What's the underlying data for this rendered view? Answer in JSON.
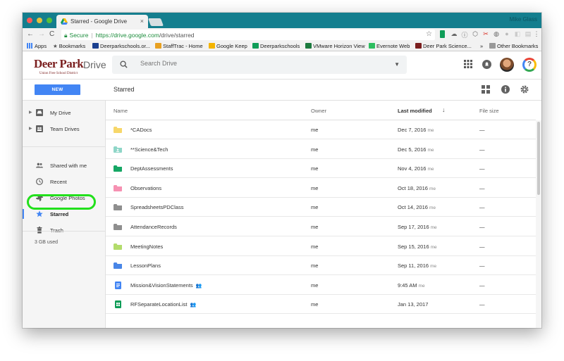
{
  "browser": {
    "tab_title": "Starred - Google Drive",
    "tab_close": "×",
    "profile_name": "Mike Glass",
    "secure_label": "Secure",
    "url_host": "https://drive.google.com",
    "url_path": "/drive/starred",
    "nav_back": "←",
    "nav_forward": "→",
    "nav_reload": "C",
    "bookmark_star": "☆"
  },
  "bookmarks": [
    {
      "label": "Apps",
      "color": "#4285f4"
    },
    {
      "label": "Bookmarks",
      "color": "#555555"
    },
    {
      "label": "Deerparkschools.or...",
      "color": "#1a3f8f"
    },
    {
      "label": "StaffTrac - Home",
      "color": "#e8a020"
    },
    {
      "label": "Google Keep",
      "color": "#f4b400"
    },
    {
      "label": "Deerparkschools",
      "color": "#0f9d58"
    },
    {
      "label": "VMware Horizon View",
      "color": "#1c7a3e"
    },
    {
      "label": "Evernote Web",
      "color": "#2dbe60"
    },
    {
      "label": "Deer Park Science...",
      "color": "#7a1e1e"
    },
    {
      "label": "»",
      "color": "#f2f2f2"
    },
    {
      "label": "Other Bookmarks",
      "color": "#999999"
    }
  ],
  "header": {
    "logo_title": "Deer Park",
    "logo_subtitle": "Union Free School District",
    "app_name": "Drive",
    "search_placeholder": "Search Drive",
    "help_glyph": "?"
  },
  "toolbar": {
    "new_label": "NEW",
    "page_title": "Starred"
  },
  "sidebar": {
    "items": [
      {
        "label": "My Drive",
        "icon": "my-drive-icon"
      },
      {
        "label": "Team Drives",
        "icon": "team-drives-icon"
      },
      {
        "label": "Shared with me",
        "icon": "shared-icon"
      },
      {
        "label": "Recent",
        "icon": "clock-icon"
      },
      {
        "label": "Google Photos",
        "icon": "photos-icon"
      },
      {
        "label": "Starred",
        "icon": "star-icon"
      },
      {
        "label": "Trash",
        "icon": "trash-icon"
      }
    ],
    "storage": "3 GB used"
  },
  "list": {
    "columns": {
      "name": "Name",
      "owner": "Owner",
      "modified": "Last modified",
      "size": "File size"
    },
    "rows": [
      {
        "name": "*CADocs",
        "owner": "me",
        "modified": "Dec 7, 2016",
        "by": "me",
        "size": "—",
        "type": "folder",
        "color": "#f7d76a",
        "shared": ""
      },
      {
        "name": "**Science&Tech",
        "owner": "me",
        "modified": "Dec 5, 2016",
        "by": "me",
        "size": "—",
        "type": "shared-folder",
        "color": "#8fd6c8",
        "shared": ""
      },
      {
        "name": "DeptAssessments",
        "owner": "me",
        "modified": "Nov 4, 2016",
        "by": "me",
        "size": "—",
        "type": "folder",
        "color": "#16a765",
        "shared": ""
      },
      {
        "name": "Observations",
        "owner": "me",
        "modified": "Oct 18, 2016",
        "by": "me",
        "size": "—",
        "type": "folder",
        "color": "#f691b2",
        "shared": ""
      },
      {
        "name": "SpreadsheetsPDClass",
        "owner": "me",
        "modified": "Oct 14, 2016",
        "by": "me",
        "size": "—",
        "type": "folder",
        "color": "#8f8f8f",
        "shared": ""
      },
      {
        "name": "AttendanceRecords",
        "owner": "me",
        "modified": "Sep 17, 2016",
        "by": "me",
        "size": "—",
        "type": "folder",
        "color": "#8f8f8f",
        "shared": ""
      },
      {
        "name": "MeetingNotes",
        "owner": "me",
        "modified": "Sep 15, 2016",
        "by": "me",
        "size": "—",
        "type": "folder",
        "color": "#b3dc6c",
        "shared": ""
      },
      {
        "name": "LessonPlans",
        "owner": "me",
        "modified": "Sep 11, 2016",
        "by": "me",
        "size": "—",
        "type": "folder",
        "color": "#4986e7",
        "shared": ""
      },
      {
        "name": "Mission&VisionStatements",
        "owner": "me",
        "modified": "9:45 AM",
        "by": "me",
        "size": "—",
        "type": "doc",
        "color": "#4285f4",
        "shared": "👥"
      },
      {
        "name": "RFSeparateLocationList",
        "owner": "me",
        "modified": "Jan 13, 2017",
        "by": "",
        "size": "—",
        "type": "sheet",
        "color": "#0f9d58",
        "shared": "👥"
      }
    ]
  }
}
